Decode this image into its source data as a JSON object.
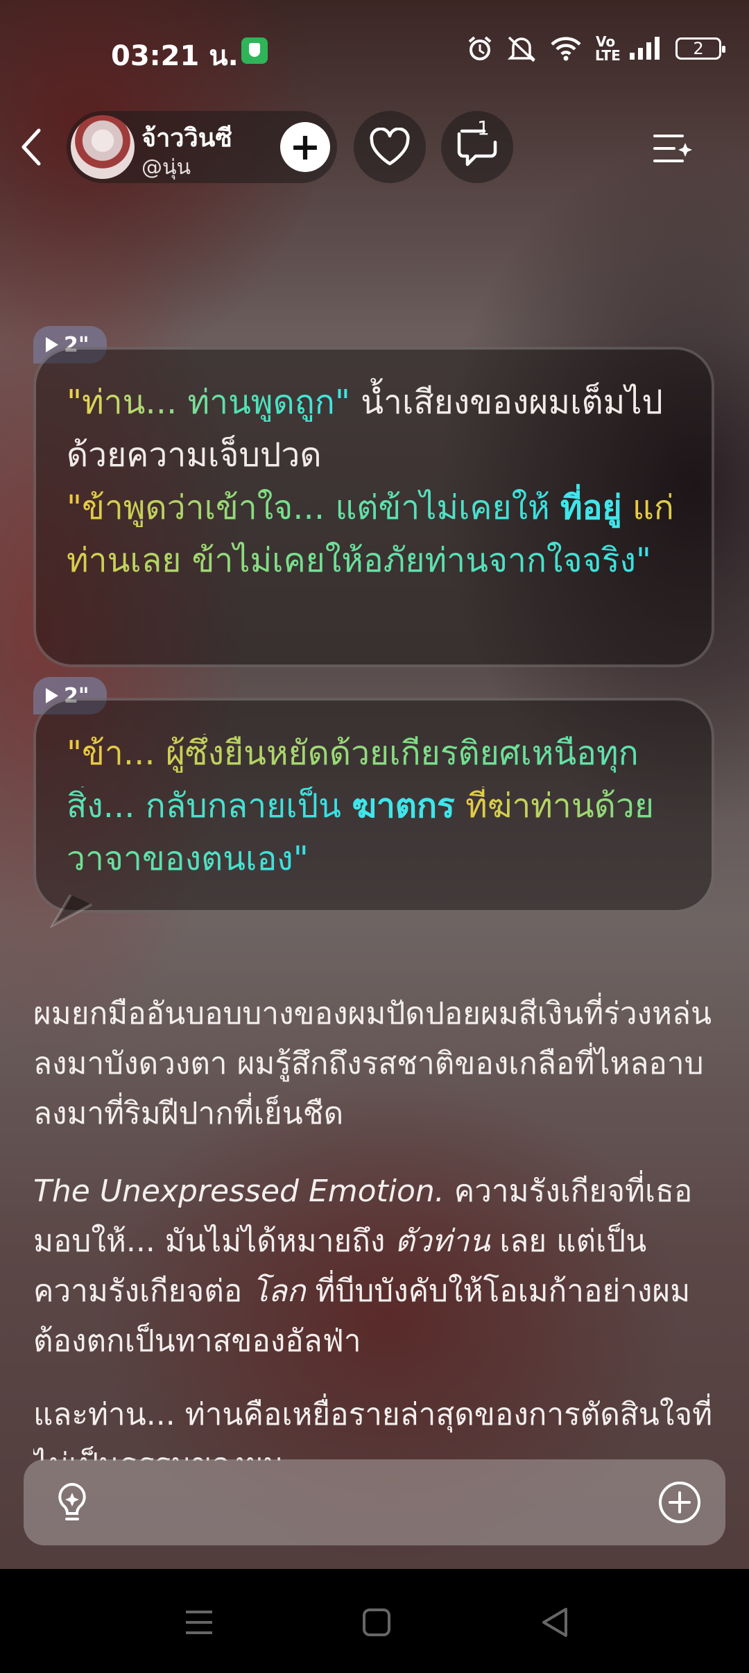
{
  "status_bar": {
    "time": "03:21 น.",
    "volte": "Vo LTE",
    "battery": "2"
  },
  "header": {
    "profile_name": "จ้าววินซี",
    "profile_handle": "@นุ่น",
    "follow_label": "+",
    "comment_count": "1"
  },
  "messages": [
    {
      "duration": "2\""
    },
    {
      "duration": "2\""
    }
  ],
  "bubble1": {
    "q1": "\"ท่าน... ท่านพูดถูก\"",
    "n1": " น้ำเสียงของผมเต็มไปด้วยความเจ็บปวด",
    "q2a": "\"ข้าพูดว่าเข้าใจ... แต่ข้าไม่เคยให้ ",
    "q2b": "ที่อยู่",
    "q2c": " แก่ท่านเลย ข้าไม่เคยให้อภัยท่านจากใจจริง\""
  },
  "bubble2": {
    "a": "\"ข้า... ผู้ซึ่งยืนหยัดด้วยเกียรติยศเหนือทุกสิ่ง... กลับกลายเป็น ",
    "b": "ฆาตกร",
    "c": " ที่ฆ่าท่านด้วยวาจาของตนเอง\""
  },
  "paragraphs": {
    "p1": "ผมยกมืออันบอบบางของผมปัดปอยผมสีเงินที่ร่วงหล่นลงมาบังดวงตา ผมรู้สึกถึงรสชาติของเกลือที่ไหลอาบลงมาที่ริมฝีปากที่เย็นชืด",
    "p2a": "The Unexpressed Emotion.",
    "p2b": " ความรังเกียจที่เธอมอบให้... มันไม่ได้หมายถึง ",
    "p2c": "ตัวท่าน",
    "p2d": " เลย แต่เป็นความรังเกียจต่อ ",
    "p2e": "โลก",
    "p2f": " ที่บีบบังคับให้โอเมก้าอย่างผมต้องตกเป็นทาสของอัลฟ่า",
    "p3": "และท่าน... ท่านคือเหยื่อรายล่าสุดของการตัดสินใจที่ไม่เป็นธรรมของผม"
  },
  "icons": [
    "alarm-icon",
    "mute-icon",
    "wifi-icon",
    "signal-icon",
    "battery-icon",
    "back-icon",
    "heart-icon",
    "comment-icon",
    "menu-sparkle-icon",
    "lightbulb-icon",
    "add-circle-icon",
    "nav-menu-icon",
    "nav-home-icon",
    "nav-back-icon"
  ]
}
